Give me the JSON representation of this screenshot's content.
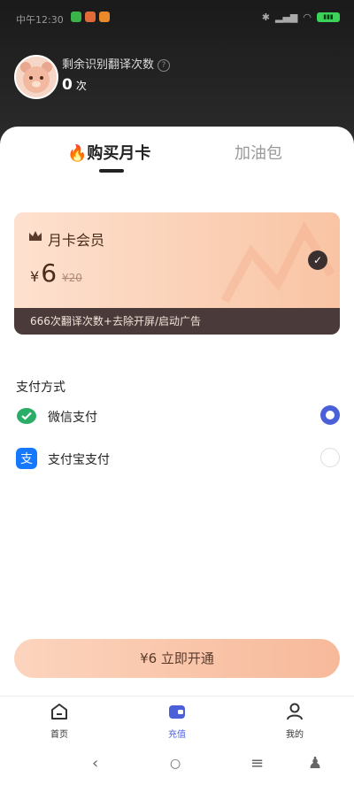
{
  "status_bar": {
    "time": "中午12:30"
  },
  "profile": {
    "title": "剩余识别翻译次数",
    "count": "0",
    "unit": "次"
  },
  "tabs": {
    "month_card": "购买月卡",
    "fuel_pack": "加油包"
  },
  "card": {
    "title": "月卡会员",
    "currency": "¥",
    "price": "6",
    "original_price": "¥20",
    "benefits": "666次翻译次数+去除开屏/启动广告"
  },
  "payment": {
    "title": "支付方式",
    "options": [
      {
        "label": "微信支付",
        "selected": true
      },
      {
        "label": "支付宝支付",
        "selected": false
      }
    ]
  },
  "cta": {
    "label": "¥6  立即开通"
  },
  "nav": {
    "home": "首页",
    "recharge": "充值",
    "mine": "我的"
  },
  "colors": {
    "accent": "#4a60d8",
    "card_start": "#fde1cf",
    "card_end": "#f9c4a4",
    "wechat": "#2aae67",
    "alipay": "#1677ff"
  }
}
